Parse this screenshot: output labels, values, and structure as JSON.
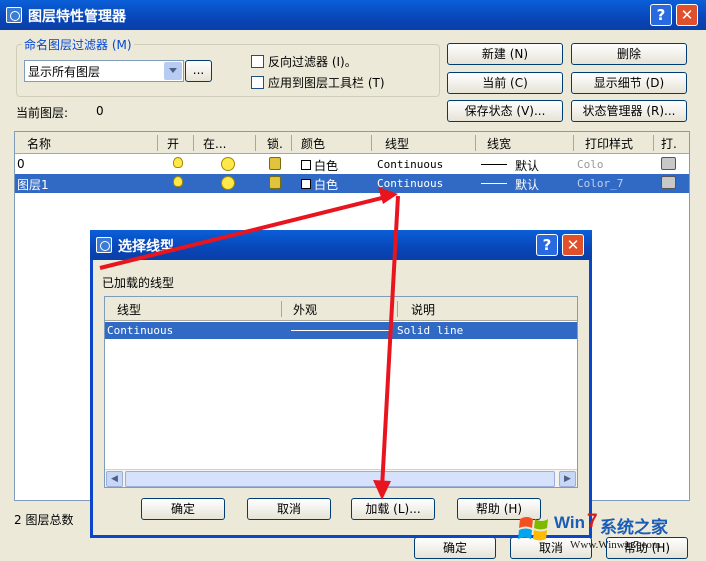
{
  "main_window": {
    "title": "图层特性管理器",
    "help_label": "?",
    "close_label": "✕",
    "filter_group_label": "命名图层过滤器 (M)",
    "filter_combo_value": "显示所有图层",
    "filter_dots_label": "...",
    "invert_filter_label": "反向过滤器 (I)。",
    "apply_toolbar_label": "应用到图层工具栏 (T)",
    "current_layer_label": "当前图层:",
    "current_layer_value": "0",
    "buttons": {
      "new": "新建 (N)",
      "delete": "删除",
      "current": "当前 (C)",
      "show_details": "显示细节 (D)",
      "save_state": "保存状态 (V)...",
      "state_manager": "状态管理器 (R)..."
    },
    "columns": [
      "名称",
      "开",
      "在...",
      "锁.",
      "颜色",
      "线型",
      "线宽",
      "打印样式",
      "打."
    ],
    "rows": [
      {
        "name": "0",
        "color": "白色",
        "linetype": "Continuous",
        "lineweight": "默认",
        "plotstyle": "Colo"
      },
      {
        "name": "图层1",
        "color": "白色",
        "linetype": "Continuous",
        "lineweight": "默认",
        "plotstyle": "Color_7"
      }
    ],
    "status_text": "2 图层总数",
    "ok_label": "确定",
    "cancel_label": "取消",
    "help_button_label": "帮助 (H)"
  },
  "dialog": {
    "title": "选择线型",
    "help_label": "?",
    "close_label": "✕",
    "loaded_label": "已加载的线型",
    "columns": [
      "线型",
      "外观",
      "说明"
    ],
    "rows": [
      {
        "linetype": "Continuous",
        "description": "Solid line"
      }
    ],
    "buttons": {
      "ok": "确定",
      "cancel": "取消",
      "load": "加载 (L)...",
      "help": "帮助 (H)"
    }
  },
  "watermark": {
    "brand_prefix": "Win",
    "brand_digit": "7",
    "brand_suffix": "系统之家",
    "url": "Www.Winwin7.com"
  },
  "colors": {
    "titlebar": "#0A46C8",
    "selection": "#316AC5",
    "arrow": "#E8141E",
    "watermark_red": "#D21E1E"
  }
}
